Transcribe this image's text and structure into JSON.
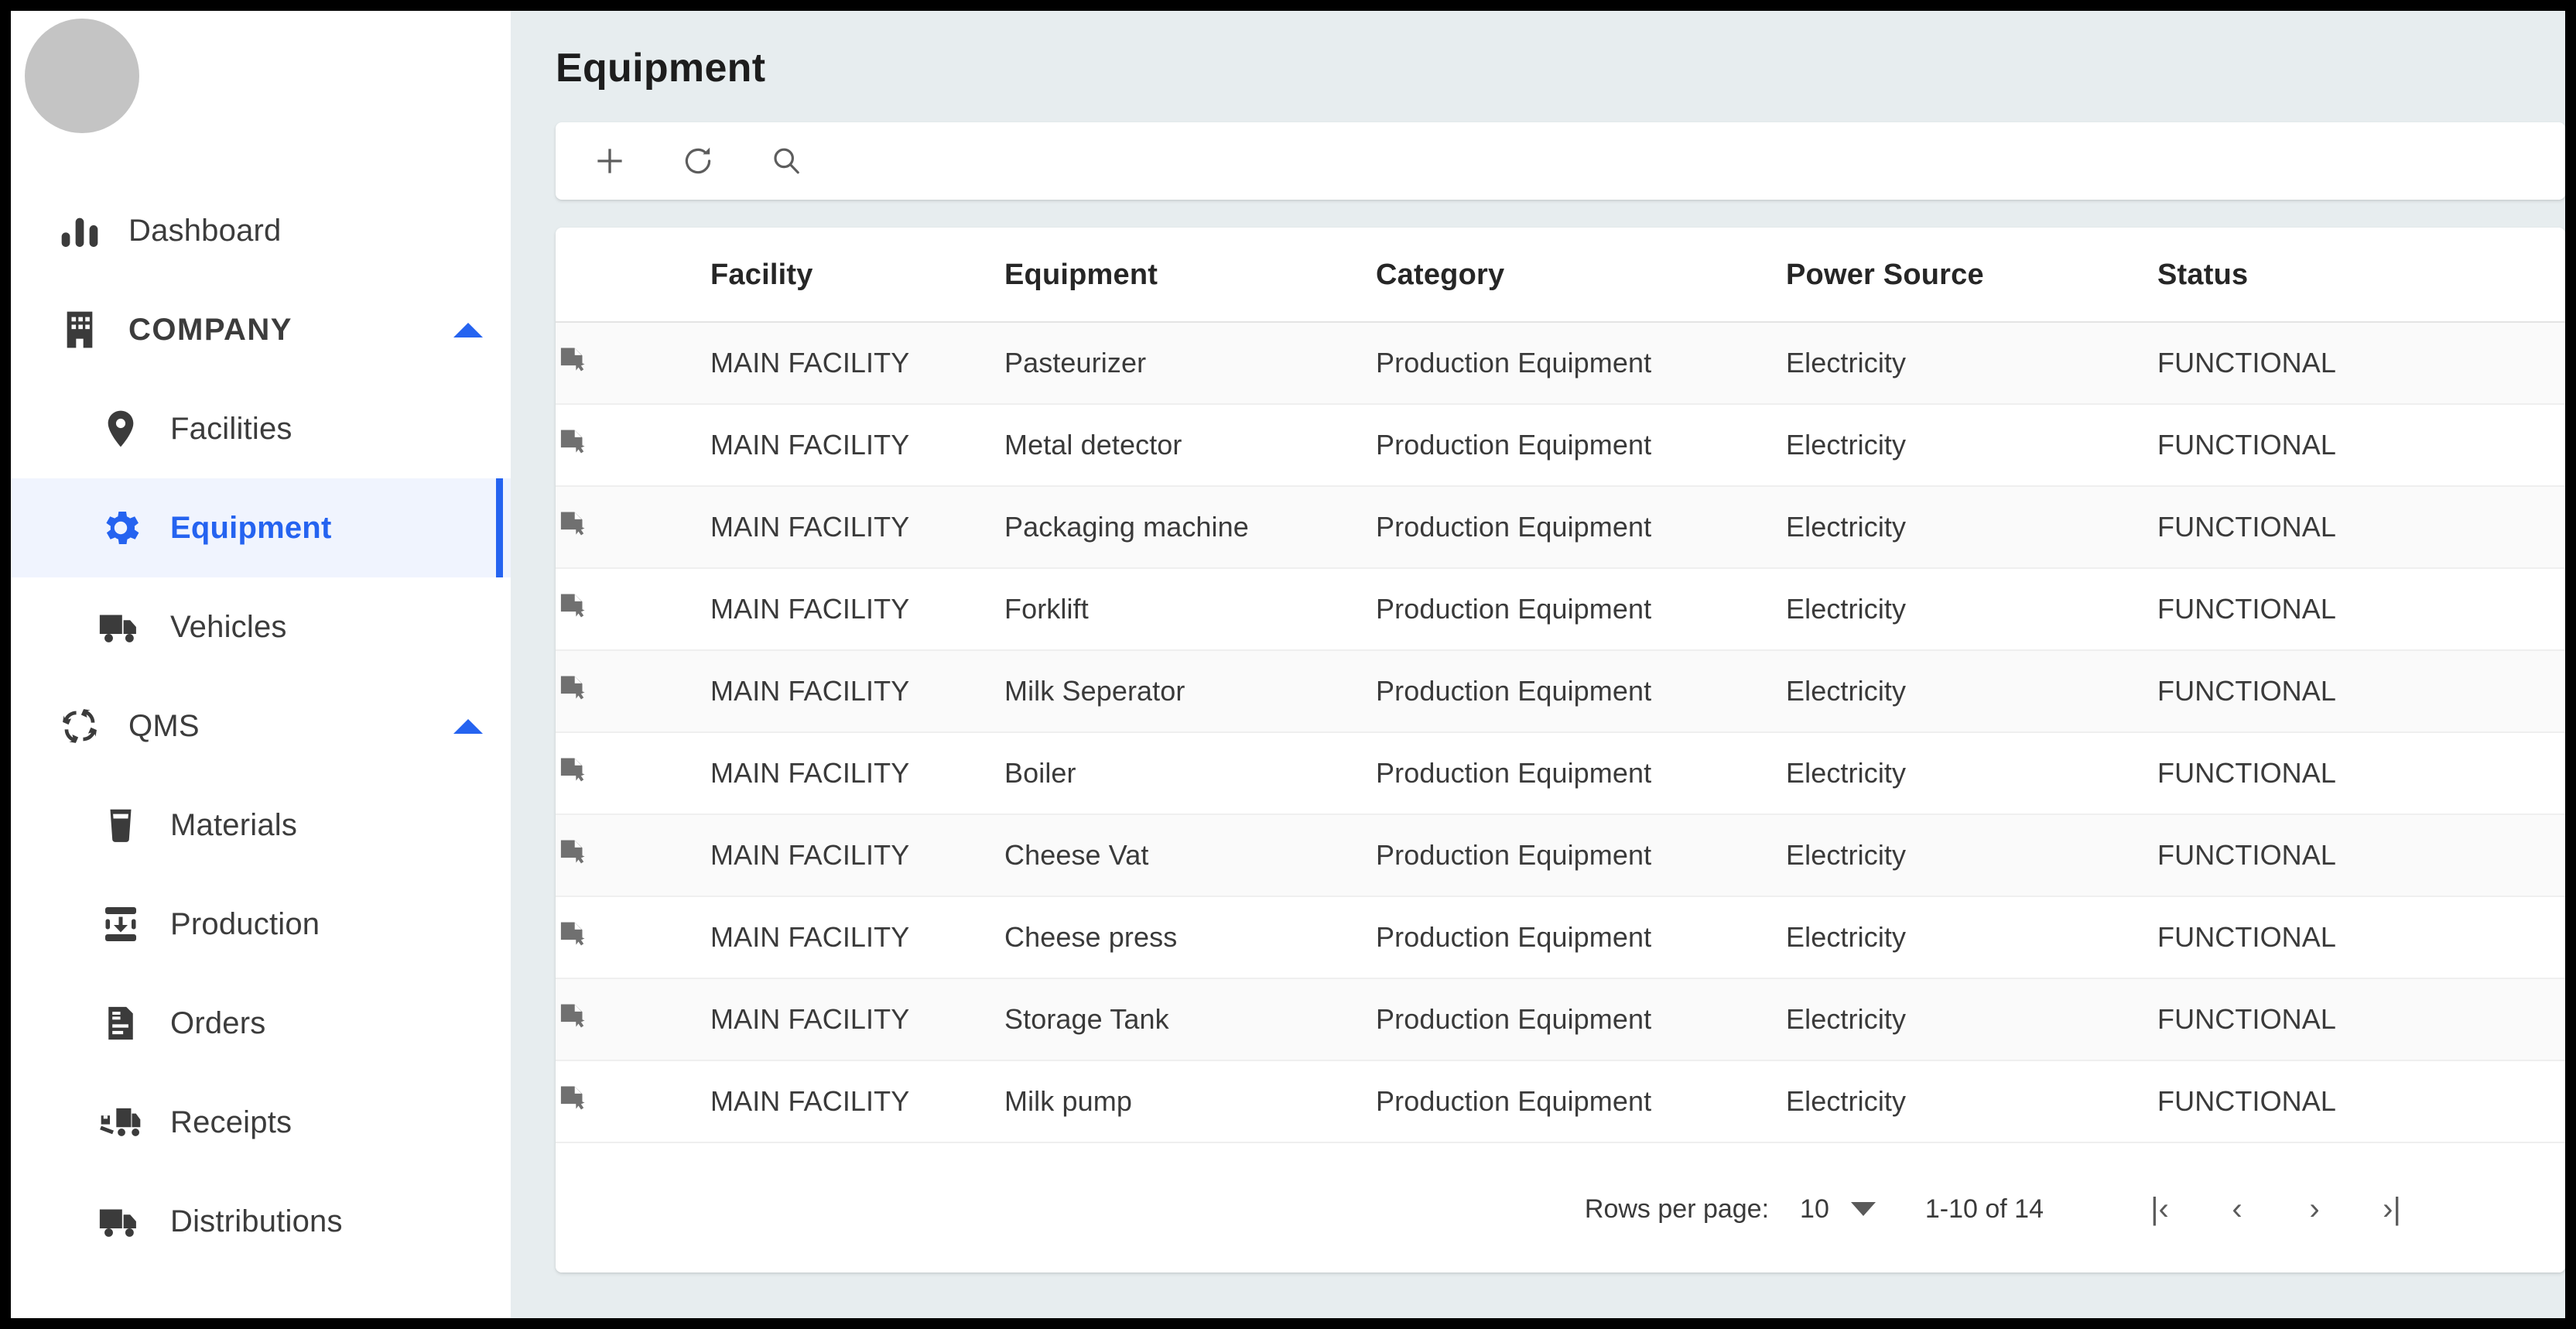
{
  "sidebar": {
    "avatar_name": "user-avatar",
    "items": [
      {
        "label": "Dashboard",
        "icon": "bar-chart-icon",
        "level": 0,
        "active": false
      },
      {
        "label": "COMPANY",
        "icon": "building-icon",
        "level": "group",
        "expanded": true,
        "active": false
      },
      {
        "label": "Facilities",
        "icon": "location-pin-icon",
        "level": 1,
        "active": false
      },
      {
        "label": "Equipment",
        "icon": "gear-icon",
        "level": 1,
        "active": true
      },
      {
        "label": "Vehicles",
        "icon": "truck-icon",
        "level": 1,
        "active": false
      },
      {
        "label": "QMS",
        "icon": "cycle-arrows-icon",
        "level": "group",
        "expanded": true,
        "active": false
      },
      {
        "label": "Materials",
        "icon": "cup-icon",
        "level": 1,
        "active": false
      },
      {
        "label": "Production",
        "icon": "production-icon",
        "level": 1,
        "active": false
      },
      {
        "label": "Orders",
        "icon": "document-list-icon",
        "level": 1,
        "active": false
      },
      {
        "label": "Receipts",
        "icon": "forklift-icon",
        "level": 1,
        "active": false
      },
      {
        "label": "Distributions",
        "icon": "truck-icon",
        "level": 1,
        "active": false
      }
    ]
  },
  "header": {
    "title": "Equipment"
  },
  "toolbar": {
    "add_label": "+",
    "refresh_label": "refresh",
    "search_label": "search"
  },
  "table": {
    "columns": [
      "",
      "Facility",
      "Equipment",
      "Category",
      "Power Source",
      "Status"
    ],
    "rows": [
      {
        "facility": "MAIN FACILITY",
        "equipment": "Pasteurizer",
        "category": "Production Equipment",
        "power": "Electricity",
        "status": "FUNCTIONAL"
      },
      {
        "facility": "MAIN FACILITY",
        "equipment": "Metal detector",
        "category": "Production Equipment",
        "power": "Electricity",
        "status": "FUNCTIONAL"
      },
      {
        "facility": "MAIN FACILITY",
        "equipment": "Packaging machine",
        "category": "Production Equipment",
        "power": "Electricity",
        "status": "FUNCTIONAL"
      },
      {
        "facility": "MAIN FACILITY",
        "equipment": "Forklift",
        "category": "Production Equipment",
        "power": "Electricity",
        "status": "FUNCTIONAL"
      },
      {
        "facility": "MAIN FACILITY",
        "equipment": "Milk Seperator",
        "category": "Production Equipment",
        "power": "Electricity",
        "status": "FUNCTIONAL"
      },
      {
        "facility": "MAIN FACILITY",
        "equipment": "Boiler",
        "category": "Production Equipment",
        "power": "Electricity",
        "status": "FUNCTIONAL"
      },
      {
        "facility": "MAIN FACILITY",
        "equipment": "Cheese Vat",
        "category": "Production Equipment",
        "power": "Electricity",
        "status": "FUNCTIONAL"
      },
      {
        "facility": "MAIN FACILITY",
        "equipment": "Cheese press",
        "category": "Production Equipment",
        "power": "Electricity",
        "status": "FUNCTIONAL"
      },
      {
        "facility": "MAIN FACILITY",
        "equipment": "Storage Tank",
        "category": "Production Equipment",
        "power": "Electricity",
        "status": "FUNCTIONAL"
      },
      {
        "facility": "MAIN FACILITY",
        "equipment": "Milk pump",
        "category": "Production Equipment",
        "power": "Electricity",
        "status": "FUNCTIONAL"
      }
    ]
  },
  "pagination": {
    "rows_per_page_label": "Rows per page:",
    "rows_per_page_value": "10",
    "range": "1-10 of 14",
    "first_label": "|‹",
    "prev_label": "‹",
    "next_label": "›",
    "last_label": "›|"
  },
  "colors": {
    "accent": "#2563f0",
    "page_bg": "#e7edef",
    "active_bg": "#f0f4fe",
    "row_alt": "#fafafa"
  }
}
